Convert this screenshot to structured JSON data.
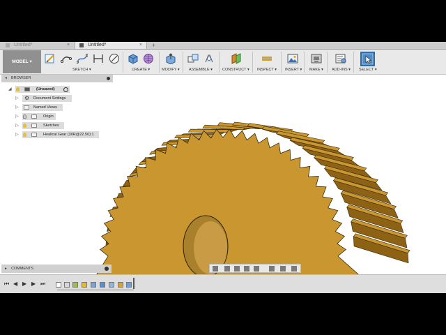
{
  "tabs": [
    {
      "label": "Untitled*",
      "active": false
    },
    {
      "label": "Untitled*",
      "active": true
    }
  ],
  "new_tab_label": "+",
  "close_glyph": "×",
  "toolbar": {
    "workspace_label": "MODEL ▾",
    "groups": [
      {
        "label": "SKETCH ▾",
        "icons": [
          "sketch-plane-icon",
          "arc-icon",
          "spline-icon",
          "dimension-icon",
          "stop-sketch-icon"
        ]
      },
      {
        "label": "CREATE ▾",
        "icons": [
          "extrude-box-icon",
          "mesh-sphere-icon"
        ]
      },
      {
        "label": "MODIFY ▾",
        "icons": [
          "press-pull-icon"
        ]
      },
      {
        "label": "ASSEMBLE ▾",
        "icons": [
          "new-component-icon",
          "joint-icon"
        ]
      },
      {
        "label": "CONSTRUCT ▾",
        "icons": [
          "offset-plane-icon"
        ]
      },
      {
        "label": "INSPECT ▾",
        "icons": [
          "measure-icon"
        ]
      },
      {
        "label": "INSERT ▾",
        "icons": [
          "insert-image-icon"
        ]
      },
      {
        "label": "MAKE ▾",
        "icons": [
          "3d-print-icon"
        ]
      },
      {
        "label": "ADD-INS ▾",
        "icons": [
          "scripts-addins-icon"
        ]
      },
      {
        "label": "SELECT ▾",
        "icons": [
          "select-cursor-icon"
        ]
      }
    ]
  },
  "browser": {
    "title": "BROWSER",
    "collapse_glyph": "◂",
    "root_label": "(Unsaved)",
    "items": [
      {
        "label": "Document Settings",
        "icon": "gear-icon"
      },
      {
        "label": "Named Views",
        "icon": "folder-icon"
      },
      {
        "label": "Origin",
        "icon": "folder-icon"
      },
      {
        "label": "Sketches",
        "icon": "folder-icon"
      },
      {
        "label": "Healical Gear (30R@22.50):1",
        "icon": "component-icon"
      }
    ]
  },
  "comments": {
    "title": "COMMENTS",
    "collapse_glyph": "▸"
  },
  "model": {
    "name": "Helical gear (30 teeth)",
    "color": "#C9962F",
    "teeth": 30
  },
  "colors": {
    "accent": "#1a6fb5",
    "gear": "#C9962F",
    "gear_shadow": "#8d6214",
    "background": "#ffffff"
  }
}
